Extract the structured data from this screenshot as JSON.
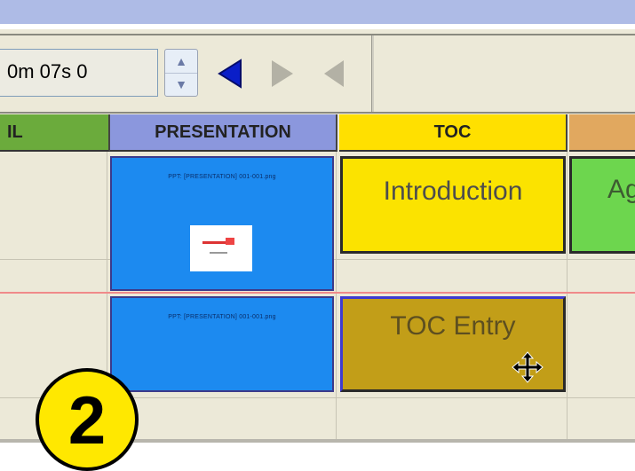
{
  "toolbar": {
    "time_value": "0m 07s 0",
    "spin_up_icon": "chevron-up-icon",
    "spin_down_icon": "chevron-down-icon",
    "nav_icons": [
      "play-reverse-icon",
      "play-forward-icon",
      "step-back-icon"
    ]
  },
  "columns": [
    {
      "label": "IL",
      "color": "#6bab3c"
    },
    {
      "label": "PRESENTATION",
      "color": "#8b97dd"
    },
    {
      "label": "TOC",
      "color": "#ffe000"
    },
    {
      "label": "",
      "color": "#e1a85f"
    }
  ],
  "presentation": {
    "slide1_file": "PPT: [PRESENTATION] 001-001.png",
    "slide2_file": "PPT: [PRESENTATION] 001-001.png"
  },
  "toc": {
    "item1": "Introduction",
    "item2": "TOC Entry",
    "item3": "Ag"
  },
  "cursor_icon": "move-cursor-icon",
  "badge_number": "2",
  "colors": {
    "slide_blue": "#1c8af0",
    "toc_yellow": "#fbe300",
    "toc_entry_gold": "#c29e18",
    "agenda_green": "#6dd64e"
  }
}
